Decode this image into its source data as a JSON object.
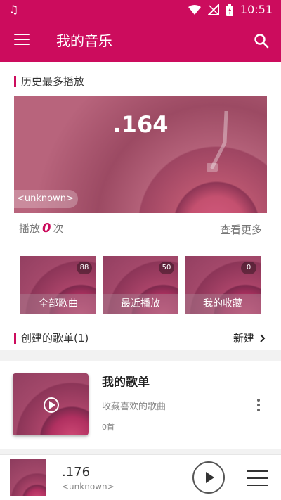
{
  "status_bar": {
    "time": "10:51",
    "music_icon": "music-note-icon"
  },
  "app_bar": {
    "title": "我的音乐"
  },
  "history": {
    "section_title": "历史最多播放",
    "track_title": ".164",
    "artist": "<unknown>",
    "plays_prefix": "播放",
    "plays_count": "0",
    "plays_suffix": "次",
    "see_more": "查看更多"
  },
  "quick_access": [
    {
      "label": "全部歌曲",
      "count": "88"
    },
    {
      "label": "最近播放",
      "count": "50"
    },
    {
      "label": "我的收藏",
      "count": "0"
    }
  ],
  "created_playlists": {
    "section_title": "创建的歌单(1)",
    "new_label": "新建",
    "items": [
      {
        "name": "我的歌单",
        "description": "收藏喜欢的歌曲",
        "count": "0首"
      }
    ]
  },
  "now_playing": {
    "title": ".176",
    "artist": "<unknown>"
  },
  "colors": {
    "primary": "#cc0c5d"
  }
}
